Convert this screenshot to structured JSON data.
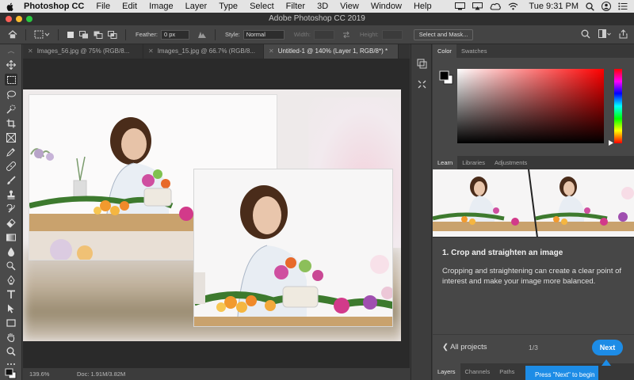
{
  "menubar": {
    "app_name": "Photoshop CC",
    "items": [
      "File",
      "Edit",
      "Image",
      "Layer",
      "Type",
      "Select",
      "Filter",
      "3D",
      "View",
      "Window",
      "Help"
    ],
    "clock": "Tue 9:31 PM"
  },
  "window": {
    "title": "Adobe Photoshop CC 2019"
  },
  "options": {
    "feather_label": "Feather:",
    "feather_value": "0 px",
    "style_label": "Style:",
    "style_value": "Normal",
    "width_label": "Width:",
    "height_label": "Height:",
    "select_mask_label": "Select and Mask..."
  },
  "tabs": [
    {
      "label": "Images_56.jpg @ 75% (RGB/8...",
      "active": false
    },
    {
      "label": "Images_15.jpg @ 66.7% (RGB/8...",
      "active": false
    },
    {
      "label": "Untitled-1 @ 140% (Layer 1, RGB/8*) *",
      "active": true
    }
  ],
  "status": {
    "zoom": "139.6%",
    "doc": "Doc: 1.91M/3.82M"
  },
  "color_panel": {
    "tabs": [
      "Color",
      "Swatches"
    ],
    "active_tab": "Color"
  },
  "learn_panel": {
    "tabs": [
      "Learn",
      "Libraries",
      "Adjustments"
    ],
    "active_tab": "Learn",
    "step_title": "1.  Crop and straighten an image",
    "step_desc": "Cropping and straightening can create a clear point of interest and make your image more balanced.",
    "all_projects": "All projects",
    "pager": "1/3",
    "next_label": "Next"
  },
  "layers_panel": {
    "tabs": [
      "Layers",
      "Channels",
      "Paths"
    ],
    "active_tab": "Layers",
    "tooltip": "Press \"Next\" to begin"
  },
  "colors": {
    "accent": "#1d8ce6",
    "picker_hue": "#ff0000"
  }
}
